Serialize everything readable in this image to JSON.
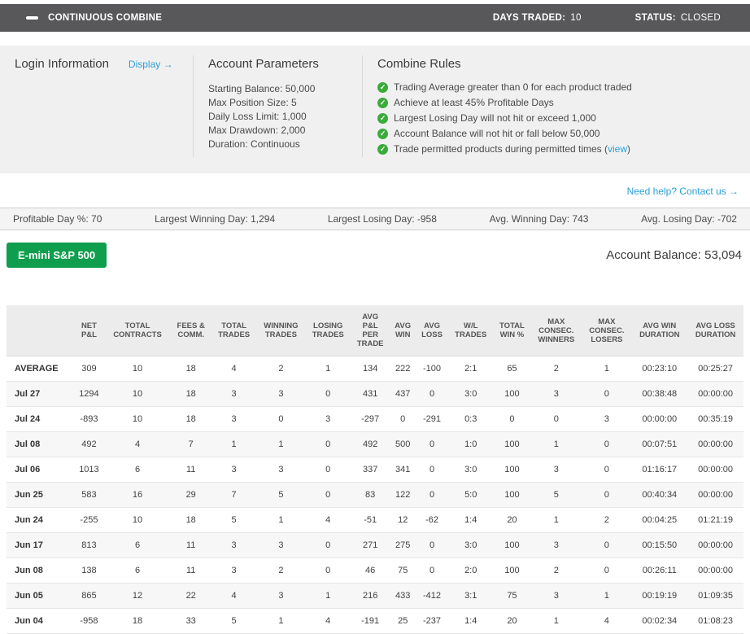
{
  "header": {
    "title": "CONTINUOUS COMBINE",
    "days_traded_label": "DAYS TRADED:",
    "days_traded_value": "10",
    "status_label": "STATUS:",
    "status_value": "CLOSED"
  },
  "panel": {
    "login": {
      "title": "Login Information",
      "display_link": "Display →"
    },
    "params": {
      "title": "Account Parameters",
      "items": [
        "Starting Balance: 50,000",
        "Max Position Size: 5",
        "Daily Loss Limit: 1,000",
        "Max Drawdown: 2,000",
        "Duration: Continuous"
      ]
    },
    "rules": {
      "title": "Combine Rules",
      "items": [
        {
          "text": "Trading Average greater than 0 for each product traded",
          "link": "",
          "suffix": ""
        },
        {
          "text": "Achieve at least 45% Profitable Days",
          "link": "",
          "suffix": ""
        },
        {
          "text": "Largest Losing Day will not hit or exceed 1,000",
          "link": "",
          "suffix": ""
        },
        {
          "text": "Account Balance will not hit or fall below 50,000",
          "link": "",
          "suffix": ""
        },
        {
          "text": "Trade permitted products during permitted times (",
          "link": "view",
          "suffix": ")"
        }
      ]
    },
    "help_link": "Need help? Contact us →"
  },
  "stats": {
    "items": [
      "Profitable Day %: 70",
      "Largest Winning Day: 1,294",
      "Largest Losing Day: -958",
      "Avg. Winning Day: 743",
      "Avg. Losing Day: -702"
    ]
  },
  "product": {
    "button_label": "E-mini S&P 500"
  },
  "balance": {
    "label": "Account Balance:",
    "value": "53,094"
  },
  "table": {
    "columns": [
      "",
      "NET\nP&L",
      "TOTAL\nCONTRACTS",
      "FEES &\nCOMM.",
      "TOTAL\nTRADES",
      "WINNING\nTRADES",
      "LOSING\nTRADES",
      "AVG\nP&L\nPER\nTRADE",
      "AVG\nWIN",
      "AVG\nLOSS",
      "W/L\nTRADES",
      "TOTAL\nWIN %",
      "MAX\nCONSEC.\nWINNERS",
      "MAX\nCONSEC.\nLOSERS",
      "AVG WIN\nDURATION",
      "AVG LOSS\nDURATION"
    ],
    "rows": [
      {
        "label": "AVERAGE",
        "cells": [
          "309",
          "10",
          "18",
          "4",
          "2",
          "1",
          "134",
          "222",
          "-100",
          "2:1",
          "65",
          "2",
          "1",
          "00:23:10",
          "00:25:27"
        ]
      },
      {
        "label": "Jul 27",
        "cells": [
          "1294",
          "10",
          "18",
          "3",
          "3",
          "0",
          "431",
          "437",
          "0",
          "3:0",
          "100",
          "3",
          "0",
          "00:38:48",
          "00:00:00"
        ]
      },
      {
        "label": "Jul 24",
        "cells": [
          "-893",
          "10",
          "18",
          "3",
          "0",
          "3",
          "-297",
          "0",
          "-291",
          "0:3",
          "0",
          "0",
          "3",
          "00:00:00",
          "00:35:19"
        ]
      },
      {
        "label": "Jul 08",
        "cells": [
          "492",
          "4",
          "7",
          "1",
          "1",
          "0",
          "492",
          "500",
          "0",
          "1:0",
          "100",
          "1",
          "0",
          "00:07:51",
          "00:00:00"
        ]
      },
      {
        "label": "Jul 06",
        "cells": [
          "1013",
          "6",
          "11",
          "3",
          "3",
          "0",
          "337",
          "341",
          "0",
          "3:0",
          "100",
          "3",
          "0",
          "01:16:17",
          "00:00:00"
        ]
      },
      {
        "label": "Jun 25",
        "cells": [
          "583",
          "16",
          "29",
          "7",
          "5",
          "0",
          "83",
          "122",
          "0",
          "5:0",
          "100",
          "5",
          "0",
          "00:40:34",
          "00:00:00"
        ]
      },
      {
        "label": "Jun 24",
        "cells": [
          "-255",
          "10",
          "18",
          "5",
          "1",
          "4",
          "-51",
          "12",
          "-62",
          "1:4",
          "20",
          "1",
          "2",
          "00:04:25",
          "01:21:19"
        ]
      },
      {
        "label": "Jun 17",
        "cells": [
          "813",
          "6",
          "11",
          "3",
          "3",
          "0",
          "271",
          "275",
          "0",
          "3:0",
          "100",
          "3",
          "0",
          "00:15:50",
          "00:00:00"
        ]
      },
      {
        "label": "Jun 08",
        "cells": [
          "138",
          "6",
          "11",
          "3",
          "2",
          "0",
          "46",
          "75",
          "0",
          "2:0",
          "100",
          "2",
          "0",
          "00:26:11",
          "00:00:00"
        ]
      },
      {
        "label": "Jun 05",
        "cells": [
          "865",
          "12",
          "22",
          "4",
          "3",
          "1",
          "216",
          "433",
          "-412",
          "3:1",
          "75",
          "3",
          "1",
          "00:19:19",
          "01:09:35"
        ]
      },
      {
        "label": "Jun 04",
        "cells": [
          "-958",
          "18",
          "33",
          "5",
          "1",
          "4",
          "-191",
          "25",
          "-237",
          "1:4",
          "20",
          "1",
          "4",
          "00:02:34",
          "01:08:23"
        ]
      }
    ]
  }
}
